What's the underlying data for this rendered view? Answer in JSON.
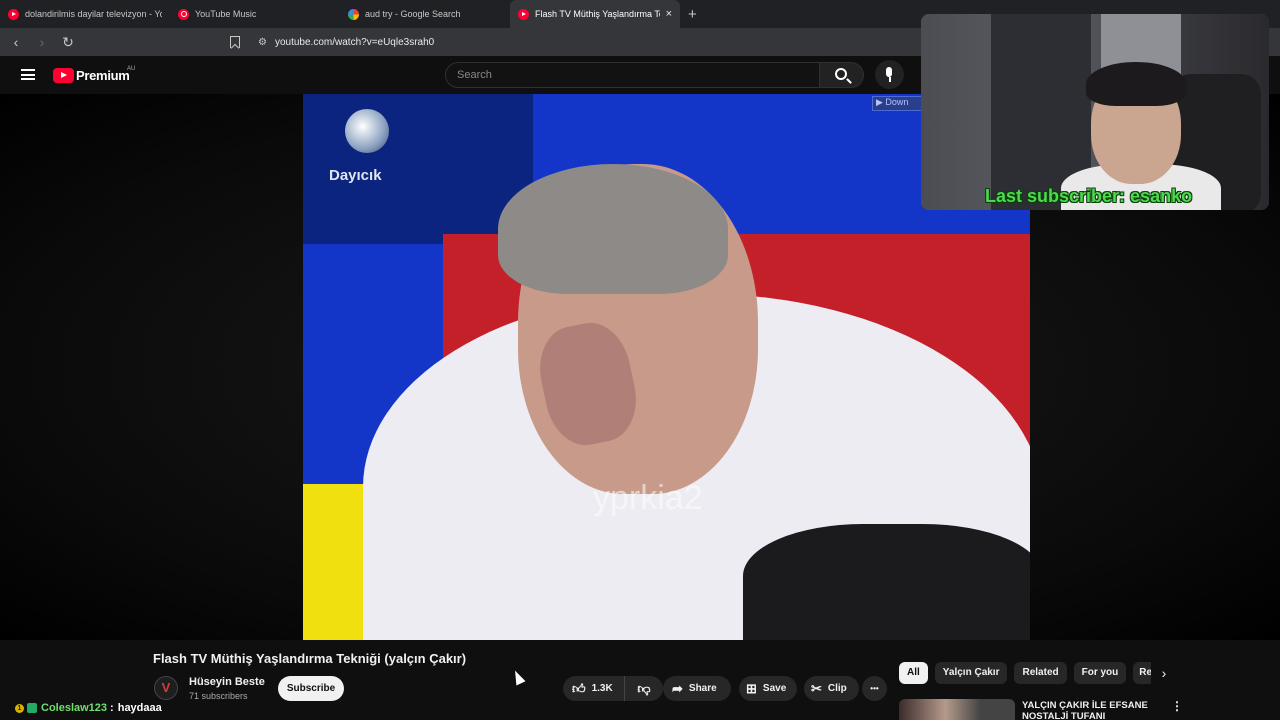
{
  "browser": {
    "tabs": [
      {
        "label": "dolandirilmis dayilar televizyon - You",
        "icon": "youtube-icon",
        "active": false
      },
      {
        "label": "YouTube Music",
        "icon": "youtube-music-icon",
        "active": false
      },
      {
        "label": "aud try - Google Search",
        "icon": "google-icon",
        "active": false
      },
      {
        "label": "Flash TV Müthiş Yaşlandırma Tek",
        "icon": "youtube-icon",
        "active": true
      }
    ],
    "close_glyph": "×",
    "newtab_glyph": "+",
    "url": "youtube.com/watch?v=eUqle3srah0"
  },
  "youtube": {
    "brand": "Premium",
    "region": "AU",
    "search_placeholder": "Search"
  },
  "video": {
    "channel_logo_text": "Dayıcık",
    "watermark": "yprkia2",
    "download_label": "▶ Down"
  },
  "webcam": {
    "overlay_text": "Last subscriber: esanko"
  },
  "details": {
    "title": "Flash TV Müthiş Yaşlandırma Tekniği (yalçın Çakır)",
    "channel": "Hüseyin Beste",
    "channel_initial": "V",
    "subscribers": "71 subscribers",
    "subscribe_label": "Subscribe",
    "likes": "1.3K",
    "share_label": "Share",
    "save_label": "Save",
    "clip_label": "Clip",
    "more_glyph": "•••"
  },
  "sidebar": {
    "chips": [
      "All",
      "Yalçın Çakır",
      "Related",
      "For you",
      "Rec"
    ],
    "active_chip": "All",
    "next_glyph": "›",
    "recommendation": {
      "title": "YALÇIN ÇAKIR İLE EFSANE NOSTALJİ TUFANI"
    }
  },
  "chat": {
    "user": "Coleslaw123",
    "separator": ":",
    "message": "haydaaa",
    "badge_text": "1"
  },
  "colors": {
    "youtube_red": "#ff0033",
    "chat_name": "#6ee06e",
    "overlay_green": "#4cd94c"
  }
}
